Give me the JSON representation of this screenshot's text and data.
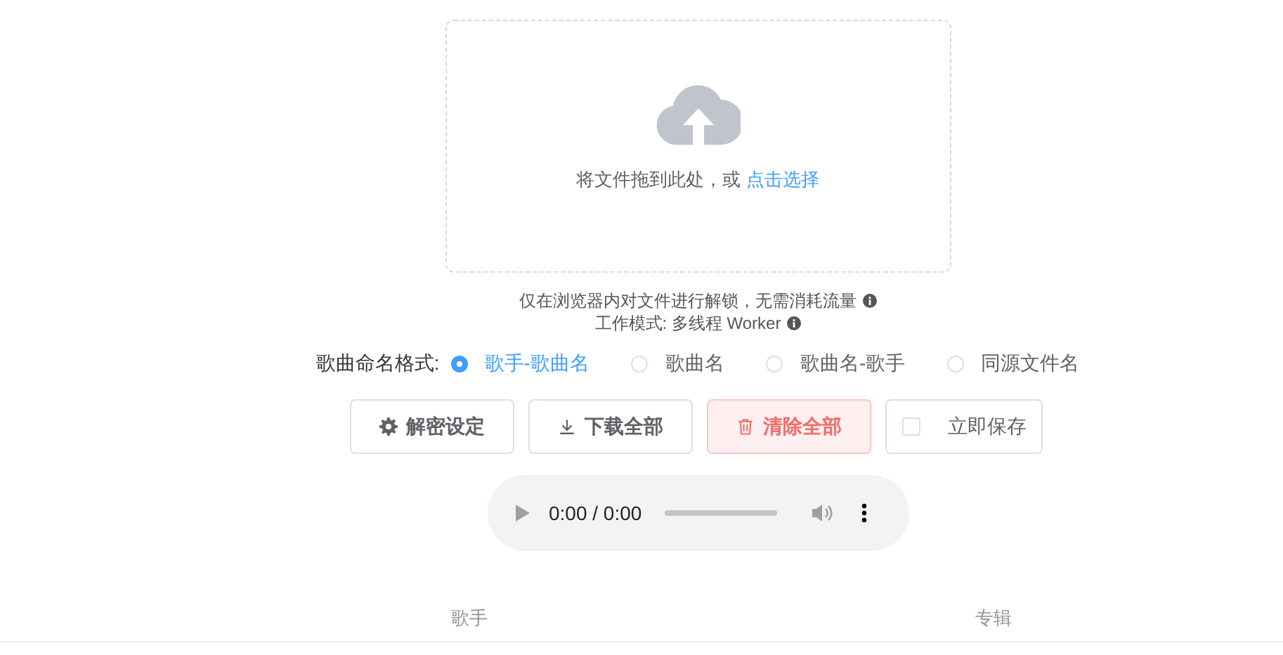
{
  "upload": {
    "hint": "将文件拖到此处，或",
    "link": "点击选择"
  },
  "notes": [
    "仅在浏览器内对文件进行解锁，无需消耗流量",
    "工作模式: 多线程 Worker"
  ],
  "naming": {
    "label": "歌曲命名格式:",
    "options": [
      {
        "label": "歌手-歌曲名",
        "selected": true
      },
      {
        "label": "歌曲名",
        "selected": false
      },
      {
        "label": "歌曲名-歌手",
        "selected": false
      },
      {
        "label": "同源文件名",
        "selected": false
      }
    ]
  },
  "buttons": [
    {
      "kind": "settings",
      "label": "解密设定"
    },
    {
      "kind": "download",
      "label": "下载全部"
    },
    {
      "kind": "clear",
      "label": "清除全部"
    },
    {
      "kind": "checkbox",
      "label": "立即保存",
      "checked": false
    }
  ],
  "player": {
    "time": "0:00 / 0:00",
    "level": 0
  },
  "table": {
    "columns": [
      "歌手",
      "专辑"
    ]
  }
}
